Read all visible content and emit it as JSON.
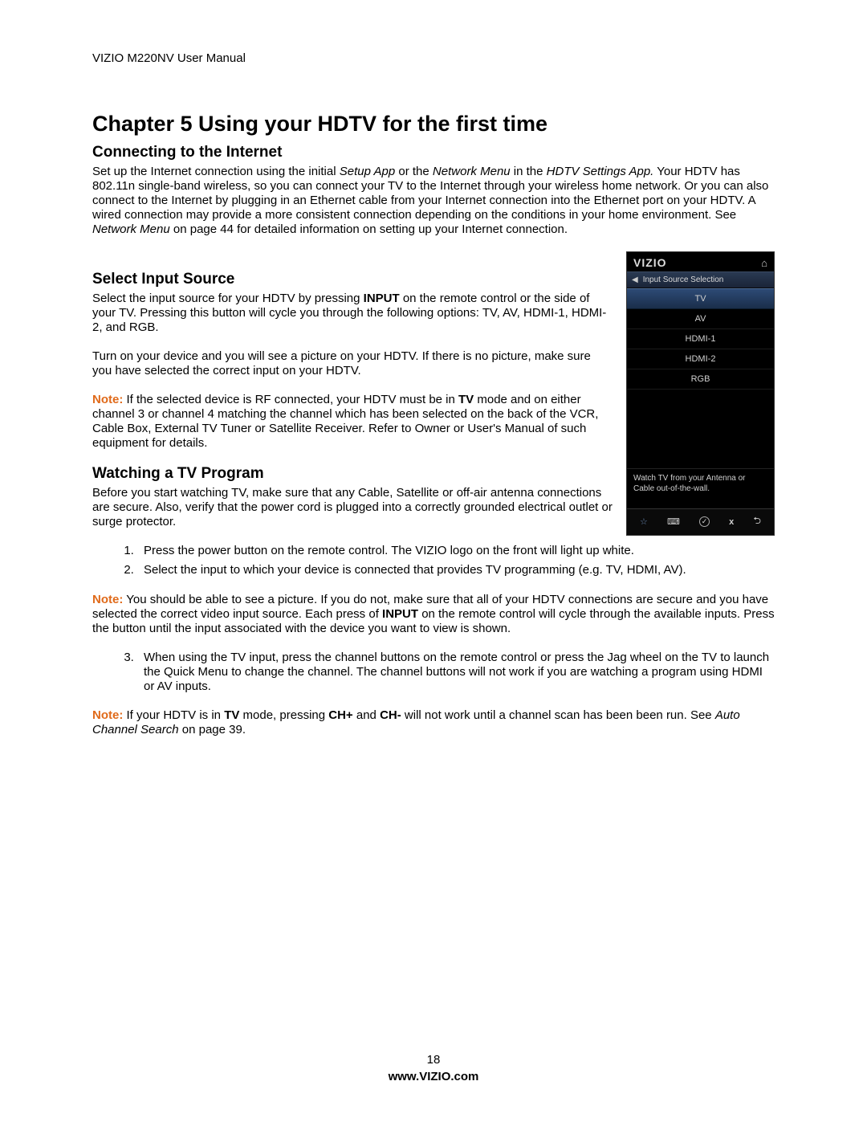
{
  "header": "VIZIO M220NV User Manual",
  "chapter_title": "Chapter 5 Using your HDTV for the first time",
  "sections": {
    "connecting": {
      "title": "Connecting to the Internet",
      "para1_a": "Set up the Internet connection using the initial ",
      "setup_app": "Setup App",
      "para1_b": " or the ",
      "network_menu": "Network Menu",
      "para1_c": " in the ",
      "hdtv_settings": "HDTV Settings App.",
      "para1_d": " Your HDTV has 802.11n single-band wireless, so you can connect your TV to the Internet through your wireless home network. Or you can also connect to the Internet by plugging in an Ethernet cable from your Internet connection into the Ethernet port on your HDTV. A wired connection may provide a more consistent connection depending on the conditions in your home environment. See ",
      "network_menu2": "Network Menu",
      "para1_e": " on page 44 for detailed information on setting up your Internet connection."
    },
    "select_input": {
      "title": "Select Input Source",
      "para1_a": "Select the input source for your HDTV by pressing ",
      "input_bold": "INPUT",
      "para1_b": " on the remote control or the side of your TV.  Pressing this button will cycle you through the following options: TV, AV, HDMI-1, HDMI-2, and RGB.",
      "para2": "Turn on your device and you will see a picture on your HDTV. If there is no picture, make sure you have selected the correct input on your HDTV.",
      "note_label": "Note:",
      "note_a": " If the selected device is RF connected, your HDTV must be in ",
      "tv_bold": "TV",
      "note_b": " mode and on either channel 3 or channel 4 matching the channel which has been selected on the back of the VCR, Cable Box, External TV Tuner or Satellite Receiver. Refer to Owner or User's Manual of such equipment for details."
    },
    "watching": {
      "title": "Watching a TV Program",
      "para1": "Before you start watching TV, make sure that any Cable, Satellite or off-air antenna connections are secure. Also, verify that the power cord is plugged into a correctly grounded electrical outlet or surge protector.",
      "step1": "Press the power button on the remote control.  The VIZIO logo on the front will light up white.",
      "step2": "Select the input to which your device is connected that provides TV programming (e.g. TV, HDMI, AV).",
      "note2_label": "Note:",
      "note2_a": " You should be able to see a picture.  If you do not, make sure that all of your HDTV connections are secure and you have selected the correct video input source. Each press of ",
      "input_bold2": "INPUT",
      "note2_b": " on the remote control will cycle through the available inputs. Press the button until the input associated with the device you want to view is shown.",
      "step3": "When using the TV input, press the channel buttons on the remote control or press the Jag wheel on the TV to launch the Quick Menu to change the channel. The channel buttons will not work if you are watching a program using HDMI or AV inputs.",
      "note3_label": "Note:",
      "note3_a": " If your HDTV is in ",
      "tv_bold2": "TV",
      "note3_b": " mode, pressing ",
      "chplus": "CH+",
      "note3_c": " and ",
      "chminus": "CH-",
      "note3_d": " will not work until a channel scan has been been run. See ",
      "auto_search": "Auto Channel Search",
      "note3_e": " on page 39."
    }
  },
  "tv_menu": {
    "logo": "VIZIO",
    "breadcrumb": "Input Source Selection",
    "items": [
      "TV",
      "AV",
      "HDMI-1",
      "HDMI-2",
      "RGB"
    ],
    "selected_index": 0,
    "help_text": "Watch TV from your Antenna or Cable out-of-the-wall."
  },
  "footer": {
    "page_number": "18",
    "site": "www.VIZIO.com"
  }
}
